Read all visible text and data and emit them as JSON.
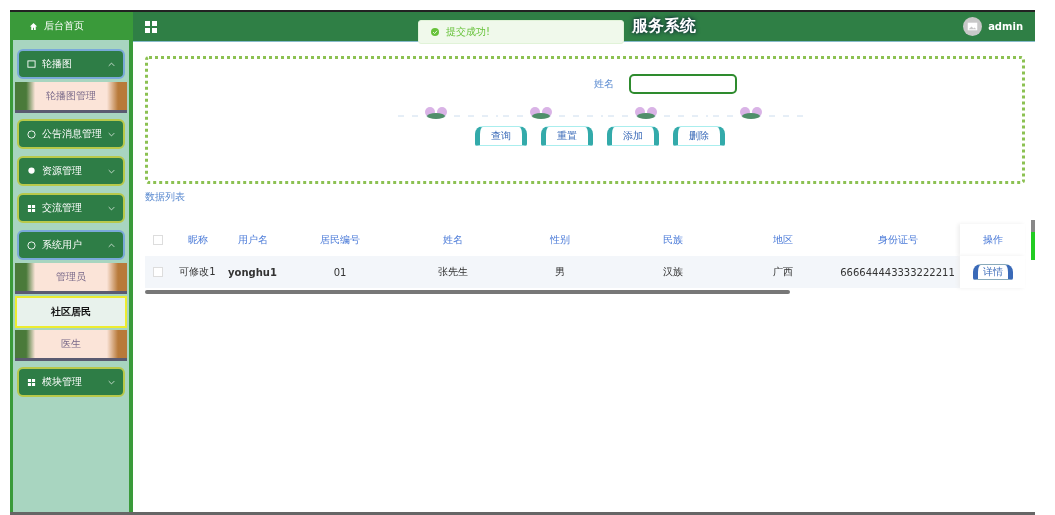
{
  "sidebar": {
    "home": "后台首页",
    "items": [
      {
        "label": "轮播图",
        "expanded": true,
        "children": [
          {
            "label": "轮播图管理",
            "selected": false
          }
        ]
      },
      {
        "label": "公告消息管理",
        "expanded": false
      },
      {
        "label": "资源管理",
        "expanded": false
      },
      {
        "label": "交流管理",
        "expanded": false
      },
      {
        "label": "系统用户",
        "expanded": true,
        "children": [
          {
            "label": "管理员",
            "selected": false
          },
          {
            "label": "社区居民",
            "selected": true
          },
          {
            "label": "医生",
            "selected": false
          }
        ]
      },
      {
        "label": "模块管理",
        "expanded": false
      }
    ]
  },
  "header": {
    "title": "服务系统",
    "user": "admin"
  },
  "toast": {
    "message": "提交成功!"
  },
  "search": {
    "label": "姓名",
    "buttons": [
      "查询",
      "重置",
      "添加",
      "删除"
    ]
  },
  "list_title": "数据列表",
  "table": {
    "select_all_checked": false,
    "columns": [
      "昵称",
      "用户名",
      "居民编号",
      "姓名",
      "性别",
      "民族",
      "地区",
      "身份证号",
      "操作"
    ],
    "rows": [
      {
        "checked": false,
        "cells": [
          "可修改1",
          "yonghu1",
          "01",
          "张先生",
          "男",
          "汉族",
          "广西",
          "666644443333222211"
        ],
        "action": "详情"
      }
    ]
  }
}
